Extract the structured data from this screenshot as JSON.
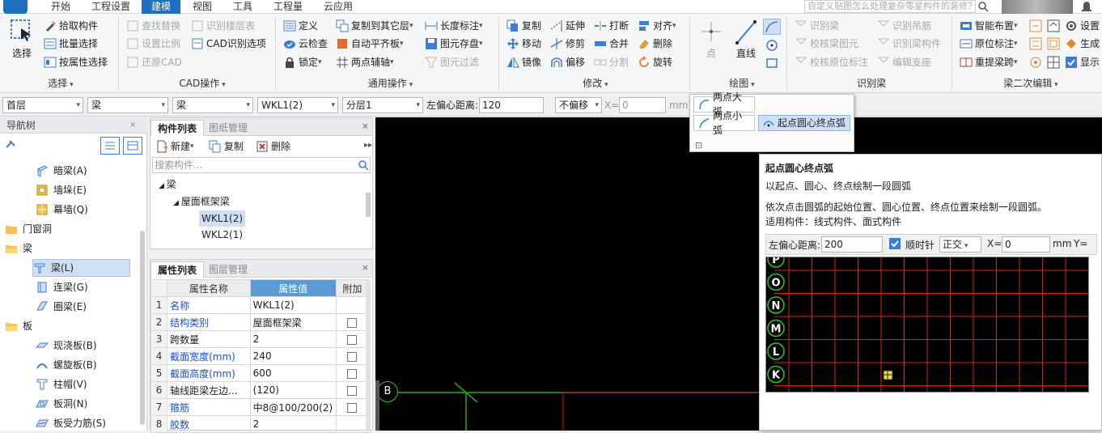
{
  "menubar": {
    "items": [
      "开始",
      "工程设置",
      "建模",
      "视图",
      "工具",
      "工程量",
      "云应用"
    ],
    "active_index": 2,
    "help_search_placeholder": "自定义贴图怎么处理复杂零星构件的装修？"
  },
  "ribbon": {
    "select": {
      "big": "选择",
      "items": [
        "拾取构件",
        "批量选择",
        "按属性选择"
      ],
      "label": "选择"
    },
    "cad": {
      "items": [
        "查找替换",
        "设置比例",
        "还原CAD",
        "识别楼层表",
        "CAD识别选项"
      ],
      "label": "CAD操作"
    },
    "general": {
      "items": [
        "定义",
        "云检查",
        "锁定",
        "复制到其它层",
        "自动平齐板",
        "两点辅轴",
        "长度标注",
        "图元存盘",
        "图元过滤"
      ],
      "label": "通用操作"
    },
    "modify": {
      "items": [
        "复制",
        "移动",
        "镜像",
        "延伸",
        "修剪",
        "偏移",
        "打断",
        "合并",
        "分割",
        "对齐",
        "删除",
        "旋转"
      ],
      "label": "修改"
    },
    "draw": {
      "point": "点",
      "line": "直线",
      "label": "绘图"
    },
    "recognize": {
      "items": [
        "识别梁",
        "校核梁图元",
        "校核原位标注",
        "识别吊筋",
        "识别梁构件",
        "编辑支座"
      ],
      "label": "识别梁"
    },
    "beam_edit": {
      "items": [
        "智能布置",
        "原位标注",
        "重提梁跨",
        "设置",
        "生成",
        "显示"
      ],
      "label": "梁二次编辑"
    }
  },
  "proptool": {
    "floor": "首层",
    "category": "梁",
    "type": "梁",
    "component": "WKL1(2)",
    "layer": "分层1",
    "offset_label": "左偏心距离:",
    "offset_value": "120",
    "no_offset": "不偏移",
    "x_label": "X=",
    "x_value": "0",
    "unit": "mm"
  },
  "navtree": {
    "title": "导航树",
    "items": [
      {
        "label": "暗梁(A)",
        "level": 2
      },
      {
        "label": "墙垛(E)",
        "level": 2
      },
      {
        "label": "幕墙(Q)",
        "level": 2
      },
      {
        "label": "门窗洞",
        "level": 1
      },
      {
        "label": "梁",
        "level": 1
      },
      {
        "label": "梁(L)",
        "level": 2,
        "selected": true
      },
      {
        "label": "连梁(G)",
        "level": 2
      },
      {
        "label": "圈梁(E)",
        "level": 2
      },
      {
        "label": "板",
        "level": 1
      },
      {
        "label": "现浇板(B)",
        "level": 2
      },
      {
        "label": "螺旋板(B)",
        "level": 2
      },
      {
        "label": "柱帽(V)",
        "level": 2
      },
      {
        "label": "板洞(N)",
        "level": 2
      },
      {
        "label": "板受力筋(S)",
        "level": 2
      }
    ]
  },
  "components": {
    "tabs": [
      "构件列表",
      "图纸管理"
    ],
    "new": "新建",
    "copy": "复制",
    "delete": "删除",
    "search_placeholder": "搜索构件...",
    "tree": [
      {
        "label": "梁",
        "level": 0
      },
      {
        "label": "屋面框架梁",
        "level": 1
      },
      {
        "label": "WKL1(2)",
        "level": 2,
        "selected": true
      },
      {
        "label": "WKL2(1)",
        "level": 2
      }
    ]
  },
  "properties": {
    "tabs": [
      "属性列表",
      "图层管理"
    ],
    "headers": [
      "属性名称",
      "属性值",
      "附加"
    ],
    "rows": [
      {
        "no": "1",
        "name": "名称",
        "value": "WKL1(2)",
        "blue": true,
        "check": false
      },
      {
        "no": "2",
        "name": "结构类别",
        "value": "屋面框架梁",
        "blue": true,
        "check": true
      },
      {
        "no": "3",
        "name": "跨数量",
        "value": "2",
        "blue": false,
        "check": true
      },
      {
        "no": "4",
        "name": "截面宽度(mm)",
        "value": "240",
        "blue": true,
        "check": true
      },
      {
        "no": "5",
        "name": "截面高度(mm)",
        "value": "600",
        "blue": true,
        "check": true
      },
      {
        "no": "6",
        "name": "轴线距梁左边...",
        "value": "(120)",
        "blue": false,
        "check": true
      },
      {
        "no": "7",
        "name": "箍筋",
        "value": "中8@100/200(2)",
        "blue": true,
        "check": true
      },
      {
        "no": "8",
        "name": "胶数",
        "value": "2",
        "blue": true,
        "check": false
      }
    ]
  },
  "canvas": {
    "axis_label": "B"
  },
  "arc_menu": {
    "items": [
      "两点大弧",
      "两点小弧",
      "起点圆心终点弧"
    ],
    "active_index": 2
  },
  "tooltip": {
    "title": "起点圆心终点弧",
    "subtitle": "以起点、圆心、终点绘制一段圆弧",
    "desc1": "依次点击圆弧的起始位置、圆心位置、终点位置来绘制一段圆弧。",
    "desc2": "适用构件：线式构件、面式构件",
    "offset_label": "左偏心距离:",
    "offset_value": "200",
    "clockwise": "顺时针",
    "ortho": "正交",
    "x_label": "X=",
    "x_value": "0",
    "unit": "mm",
    "y_label": "Y=",
    "axis_labels": [
      "P",
      "O",
      "N",
      "M",
      "L",
      "K"
    ]
  }
}
